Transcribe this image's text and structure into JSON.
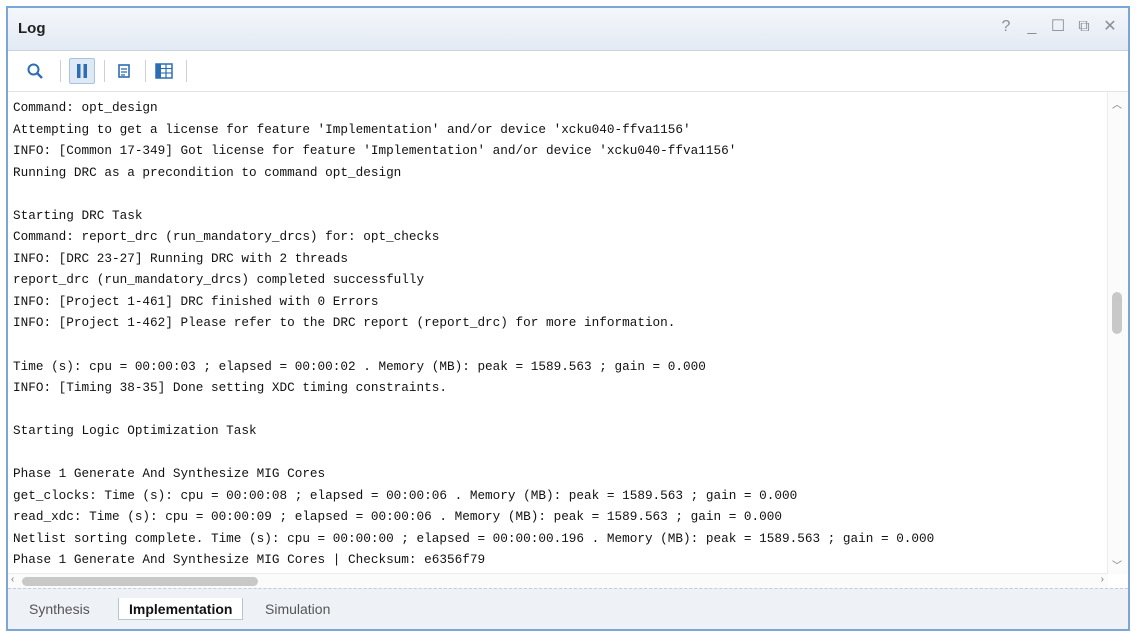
{
  "window": {
    "title": "Log"
  },
  "window_controls": {
    "help": "?",
    "minimize": "_",
    "maximize": "☐",
    "restore": "⧉",
    "close": "✕"
  },
  "toolbar": {
    "icons": [
      "search-icon",
      "pause-icon",
      "copy-icon",
      "table-icon"
    ]
  },
  "log": {
    "lines": [
      "Command: opt_design",
      "Attempting to get a license for feature 'Implementation' and/or device 'xcku040-ffva1156'",
      "INFO: [Common 17-349] Got license for feature 'Implementation' and/or device 'xcku040-ffva1156'",
      "Running DRC as a precondition to command opt_design",
      "",
      "Starting DRC Task",
      "Command: report_drc (run_mandatory_drcs) for: opt_checks",
      "INFO: [DRC 23-27] Running DRC with 2 threads",
      "report_drc (run_mandatory_drcs) completed successfully",
      "INFO: [Project 1-461] DRC finished with 0 Errors",
      "INFO: [Project 1-462] Please refer to the DRC report (report_drc) for more information.",
      "",
      "Time (s): cpu = 00:00:03 ; elapsed = 00:00:02 . Memory (MB): peak = 1589.563 ; gain = 0.000",
      "INFO: [Timing 38-35] Done setting XDC timing constraints.",
      "",
      "Starting Logic Optimization Task",
      "",
      "Phase 1 Generate And Synthesize MIG Cores",
      "get_clocks: Time (s): cpu = 00:00:08 ; elapsed = 00:00:06 . Memory (MB): peak = 1589.563 ; gain = 0.000",
      "read_xdc: Time (s): cpu = 00:00:09 ; elapsed = 00:00:06 . Memory (MB): peak = 1589.563 ; gain = 0.000",
      "Netlist sorting complete. Time (s): cpu = 00:00:00 ; elapsed = 00:00:00.196 . Memory (MB): peak = 1589.563 ; gain = 0.000",
      "Phase 1 Generate And Synthesize MIG Cores | Checksum: e6356f79"
    ]
  },
  "tabs": [
    {
      "label": "Synthesis"
    },
    {
      "label": "Implementation"
    },
    {
      "label": "Simulation"
    }
  ]
}
